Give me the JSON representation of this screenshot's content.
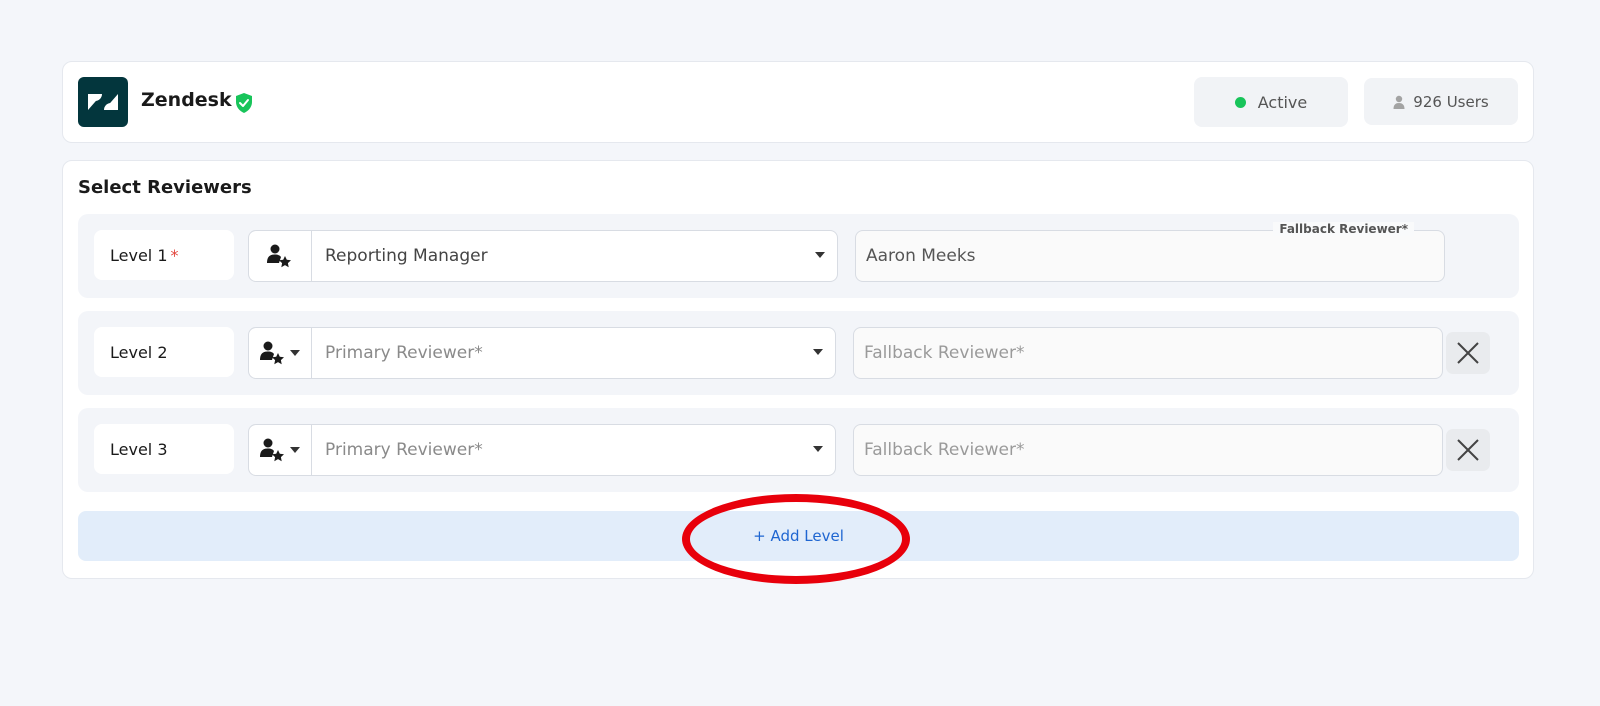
{
  "app": {
    "name": "Zendesk",
    "logo_icon": "zendesk-logo",
    "verified_icon": "shield-check-icon",
    "status": "Active",
    "status_color": "#18c45a",
    "users": "926 Users",
    "users_icon": "user-icon"
  },
  "reviewers": {
    "title": "Select Reviewers",
    "levels": [
      {
        "label": "Level 1",
        "required_mark": "*",
        "primary_value": "Reporting Manager",
        "fallback_value": "Aaron Meeks",
        "fallback_floating_label": "Fallback Reviewer*"
      },
      {
        "label": "Level 2",
        "primary_placeholder": "Primary Reviewer*",
        "fallback_placeholder": "Fallback Reviewer*"
      },
      {
        "label": "Level 3",
        "primary_placeholder": "Primary Reviewer*",
        "fallback_placeholder": "Fallback Reviewer*"
      }
    ],
    "add_level_label": "+ Add Level"
  },
  "colors": {
    "brand": "#03363d",
    "accent": "#1f66d1",
    "annotation": "#e8000b"
  }
}
